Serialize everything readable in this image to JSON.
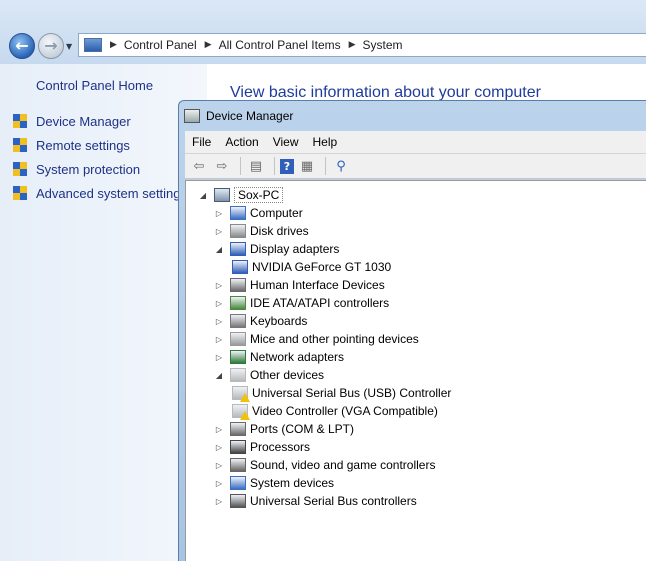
{
  "explorer": {
    "breadcrumb": [
      "Control Panel",
      "All Control Panel Items",
      "System"
    ]
  },
  "left_pane": {
    "home": "Control Panel Home",
    "links": [
      "Device Manager",
      "Remote settings",
      "System protection",
      "Advanced system settings"
    ]
  },
  "main": {
    "title": "View basic information about your computer"
  },
  "device_manager": {
    "title": "Device Manager",
    "menu": [
      "File",
      "Action",
      "View",
      "Help"
    ],
    "toolbar_icons": [
      "back-icon",
      "forward-icon",
      "properties-icon",
      "help-icon",
      "console-tree-icon",
      "scan-hardware-icon"
    ],
    "tree": {
      "root": "Sox-PC",
      "items": [
        {
          "label": "Computer",
          "expanded": false,
          "icon": "computer-icon"
        },
        {
          "label": "Disk drives",
          "expanded": false,
          "icon": "disk-drive-icon"
        },
        {
          "label": "Display adapters",
          "expanded": true,
          "icon": "monitor-icon"
        },
        {
          "label": "NVIDIA GeForce GT 1030",
          "child": true,
          "icon": "monitor-icon"
        },
        {
          "label": "Human Interface Devices",
          "expanded": false,
          "icon": "hid-icon"
        },
        {
          "label": "IDE ATA/ATAPI controllers",
          "expanded": false,
          "icon": "ide-controller-icon"
        },
        {
          "label": "Keyboards",
          "expanded": false,
          "icon": "keyboard-icon"
        },
        {
          "label": "Mice and other pointing devices",
          "expanded": false,
          "icon": "mouse-icon"
        },
        {
          "label": "Network adapters",
          "expanded": false,
          "icon": "network-icon"
        },
        {
          "label": "Other devices",
          "expanded": true,
          "icon": "unknown-device-icon"
        },
        {
          "label": "Universal Serial Bus (USB) Controller",
          "child": true,
          "warning": true,
          "icon": "unknown-device-icon"
        },
        {
          "label": "Video Controller (VGA Compatible)",
          "child": true,
          "warning": true,
          "icon": "unknown-device-icon"
        },
        {
          "label": "Ports (COM & LPT)",
          "expanded": false,
          "icon": "port-icon"
        },
        {
          "label": "Processors",
          "expanded": false,
          "icon": "processor-icon"
        },
        {
          "label": "Sound, video and game controllers",
          "expanded": false,
          "icon": "speaker-icon"
        },
        {
          "label": "System devices",
          "expanded": false,
          "icon": "computer-icon"
        },
        {
          "label": "Universal Serial Bus controllers",
          "expanded": false,
          "icon": "usb-icon"
        }
      ]
    }
  },
  "colors": {
    "link": "#1e3287",
    "title_blue": "#1e3c9b",
    "warning": "#f2c20a"
  }
}
